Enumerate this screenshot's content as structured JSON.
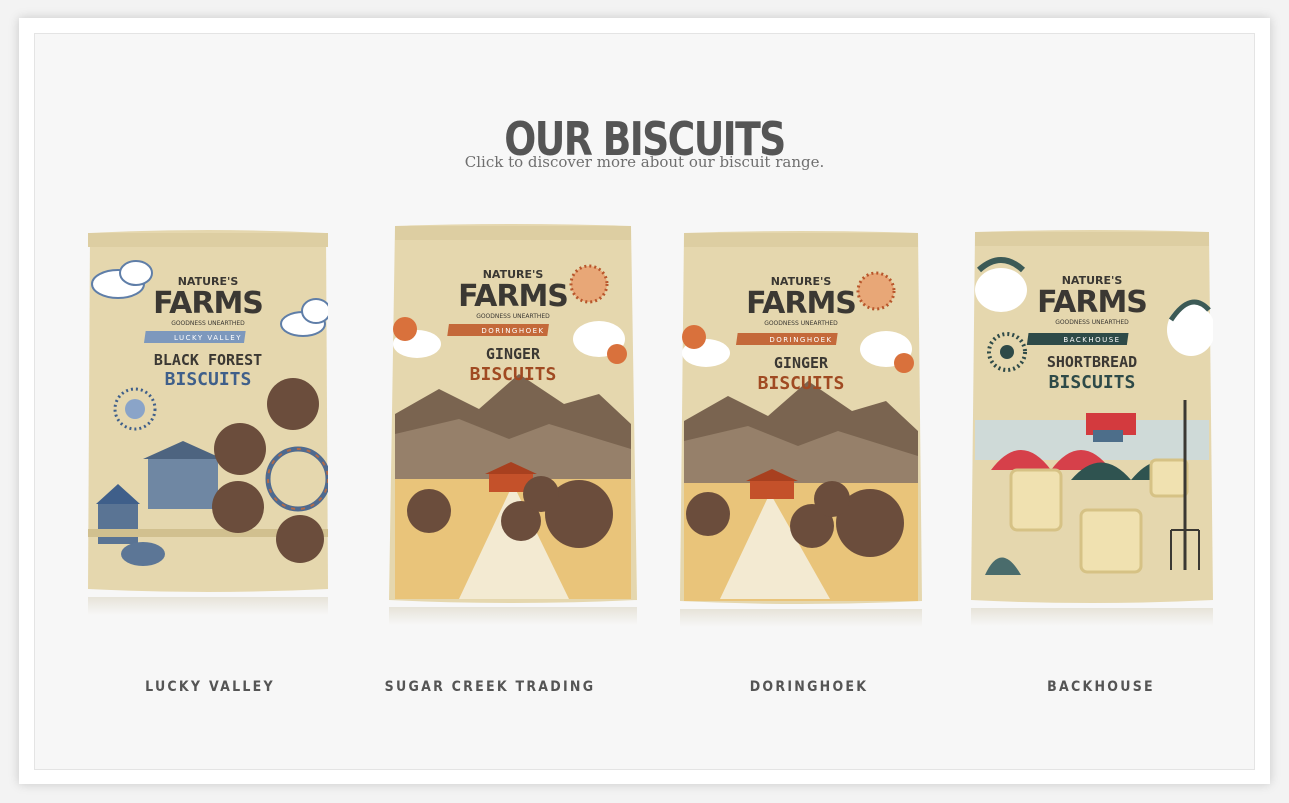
{
  "section": {
    "title": "OUR BISCUITS",
    "subtitle": "Click to discover more about our biscuit range."
  },
  "brand": {
    "top": "NATURE'S",
    "name": "FARMS",
    "tagline": "GOODNESS UNEARTHED"
  },
  "products": [
    {
      "label": "LUCKY VALLEY",
      "ribbon": "LUCKY VALLEY",
      "flavour": "BLACK FOREST",
      "type": "BISCUITS",
      "accent": "#3f5f8a"
    },
    {
      "label": "SUGAR CREEK TRADING",
      "ribbon": "DORINGHOEK",
      "flavour": "GINGER",
      "type": "BISCUITS",
      "accent": "#a04a22"
    },
    {
      "label": "DORINGHOEK",
      "ribbon": "DORINGHOEK",
      "flavour": "GINGER",
      "type": "BISCUITS",
      "accent": "#a04a22"
    },
    {
      "label": "BACKHOUSE",
      "ribbon": "BACKHOUSE",
      "flavour": "SHORTBREAD",
      "type": "BISCUITS",
      "accent": "#2e4a48"
    }
  ],
  "colors": {
    "bag": "#e5d7ae",
    "brand_text": "#3b3833",
    "title_text": "#555555"
  }
}
